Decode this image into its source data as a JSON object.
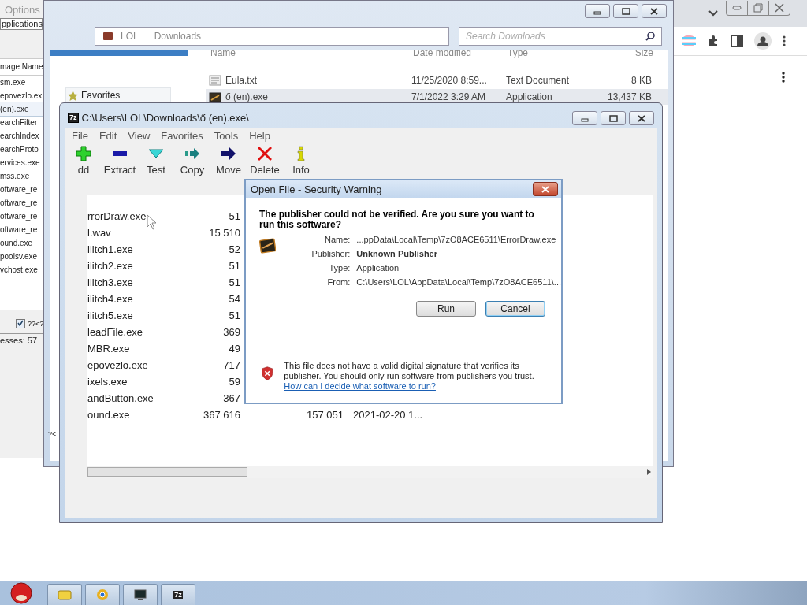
{
  "task_manager": {
    "menu": [
      "Options"
    ],
    "tabs": [
      {
        "label": "pplications",
        "selected": true
      }
    ],
    "column": "mage Name",
    "processes": [
      {
        "name": "sm.exe",
        "selected": false
      },
      {
        "name": "epovezlo.ex",
        "selected": false
      },
      {
        "name": "(en).exe",
        "selected": true
      },
      {
        "name": "earchFilter",
        "selected": false
      },
      {
        "name": "earchIndex",
        "selected": false
      },
      {
        "name": "earchProto",
        "selected": false
      },
      {
        "name": "ervices.exe",
        "selected": false
      },
      {
        "name": "mss.exe",
        "selected": false
      },
      {
        "name": "oftware_re",
        "selected": false
      },
      {
        "name": "oftware_re",
        "selected": false
      },
      {
        "name": "oftware_re",
        "selected": false
      },
      {
        "name": "oftware_re",
        "selected": false
      },
      {
        "name": "ound.exe",
        "selected": false
      },
      {
        "name": "poolsv.exe",
        "selected": false
      },
      {
        "name": "vchost.exe",
        "selected": false
      }
    ],
    "checkbox": {
      "label": "??<?",
      "checked": true
    },
    "status": "esses: 57",
    "stray": "?<"
  },
  "explorer": {
    "breadcrumbs": [
      "LOL",
      "Downloads"
    ],
    "search": {
      "placeholder": "Search Downloads"
    },
    "sidebar": [
      {
        "label": "Favorites"
      }
    ],
    "columns": [
      "Name",
      "Date modified",
      "Type",
      "Size"
    ],
    "files": [
      {
        "name": "Eula.txt",
        "kind": "text",
        "date": "11/25/2020 8:59...",
        "type": "Text Document",
        "size": "8 KB",
        "selected": false
      },
      {
        "name": "ő (en).exe",
        "kind": "app",
        "date": "7/1/2022 3:29 AM",
        "type": "Application",
        "size": "13,437 KB",
        "selected": true
      }
    ]
  },
  "archive_window": {
    "logo": "7z",
    "title": "C:\\Users\\LOL\\Downloads\\ő (en).exe\\",
    "menu": [
      "File",
      "Edit",
      "View",
      "Favorites",
      "Tools",
      "Help"
    ],
    "toolbar": [
      {
        "label": "dd",
        "kind": "add"
      },
      {
        "label": "Extract",
        "kind": "extract"
      },
      {
        "label": "Test",
        "kind": "test"
      },
      {
        "label": "Copy",
        "kind": "copy"
      },
      {
        "label": "Move",
        "kind": "move"
      },
      {
        "label": "Delete",
        "kind": "delete"
      },
      {
        "label": "Info",
        "kind": "info"
      }
    ],
    "rows": [
      {
        "name": "rrorDraw.exe",
        "size": "51"
      },
      {
        "name": "l.wav",
        "size": "15 510"
      },
      {
        "name": "ilitch1.exe",
        "size": "52"
      },
      {
        "name": "ilitch2.exe",
        "size": "51"
      },
      {
        "name": "ilitch3.exe",
        "size": "51"
      },
      {
        "name": "ilitch4.exe",
        "size": "54"
      },
      {
        "name": "ilitch5.exe",
        "size": "51"
      },
      {
        "name": "leadFile.exe",
        "size": "369"
      },
      {
        "name": "MBR.exe",
        "size": "49"
      },
      {
        "name": "epovezlo.exe",
        "size": "717"
      },
      {
        "name": "ixels.exe",
        "size": "59"
      },
      {
        "name": "andButton.exe",
        "size": "367"
      },
      {
        "name": "ound.exe",
        "size": "367 616",
        "packed": "157 051",
        "modified": "2021-02-20 1..."
      }
    ]
  },
  "dialog": {
    "title": "Open File - Security Warning",
    "heading": "The publisher could not be verified.  Are you sure you want to run this software?",
    "fields": [
      {
        "label": "Name:",
        "value": "...ppData\\Local\\Temp\\7zO8ACE6511\\ErrorDraw.exe",
        "bold": false
      },
      {
        "label": "Publisher:",
        "value": "Unknown Publisher",
        "bold": true
      },
      {
        "label": "Type:",
        "value": "Application",
        "bold": false
      },
      {
        "label": "From:",
        "value": "C:\\Users\\LOL\\AppData\\Local\\Temp\\7zO8ACE6511\\...",
        "bold": false
      }
    ],
    "buttons": [
      {
        "label": "Run",
        "selected": false
      },
      {
        "label": "Cancel",
        "selected": true
      }
    ],
    "warning": "This file does not have a valid digital signature that verifies its publisher.  You should only run software from publishers you trust.",
    "link": "How can I decide what software to run?"
  },
  "taskbar": {
    "items": [
      {
        "kind": "folder"
      },
      {
        "kind": "browser"
      },
      {
        "kind": "monitor"
      },
      {
        "kind": "archive",
        "label": "7z"
      }
    ]
  }
}
